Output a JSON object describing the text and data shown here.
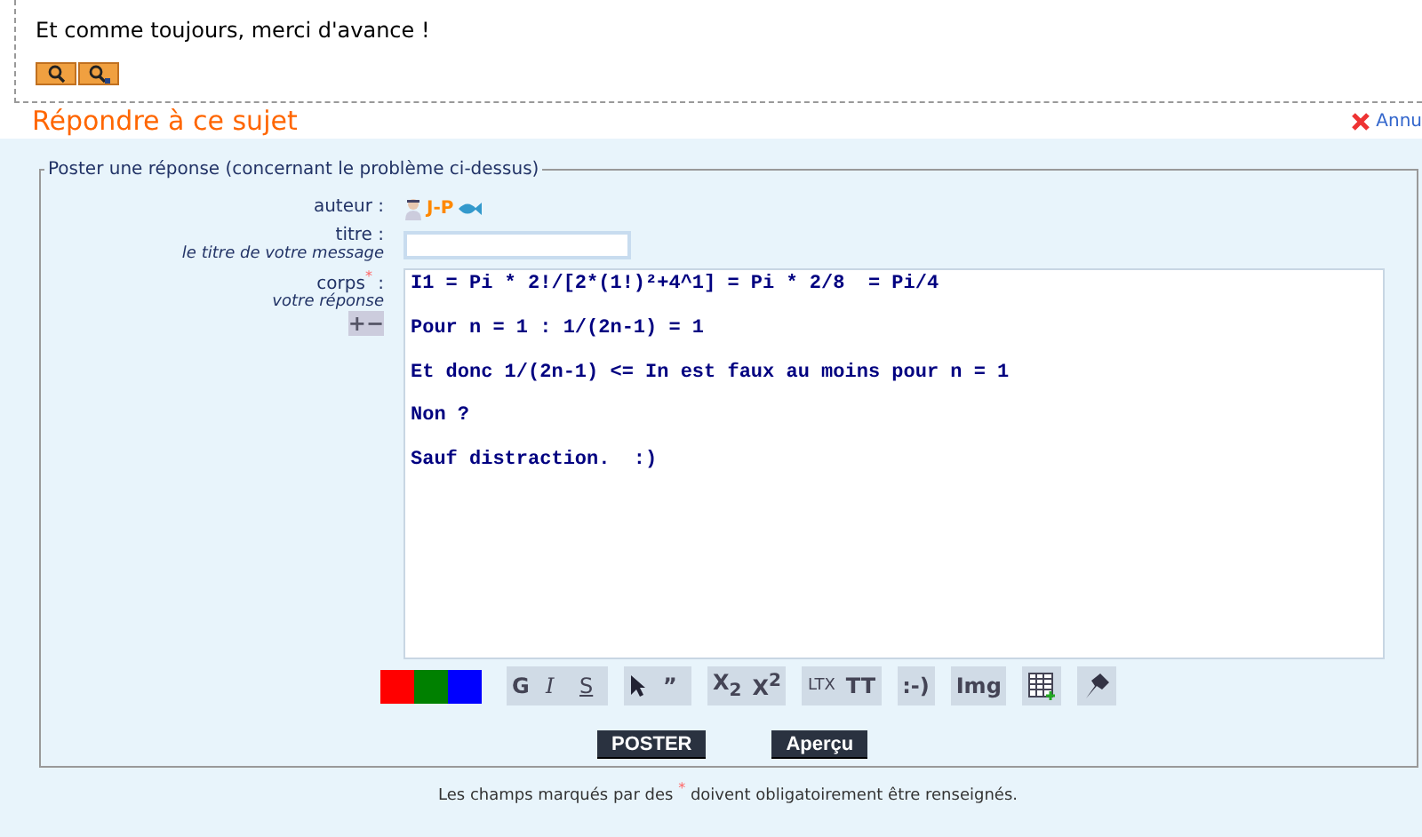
{
  "message": {
    "text": "Et comme toujours, merci d'avance !"
  },
  "reply": {
    "title": "Répondre à ce sujet",
    "cancel": "Annu"
  },
  "form": {
    "legend": "Poster une réponse (concernant le problème ci-dessus)",
    "author_label": "auteur :",
    "author": "J-P",
    "title_label": "titre :",
    "title_hint": "le titre de votre message",
    "body_label": "corps",
    "required_mark": "*",
    "body_colon": ":",
    "body_hint": "votre réponse",
    "resize_controls": "+−",
    "body_paragraphs": [
      "I1 = Pi * 2!/[2*(1!)²+4^1] = Pi * 2/8  = Pi/4",
      "Pour n = 1 : 1/(2n-1) = 1",
      "Et donc 1/(2n-1) <= In est faux au moins pour n = 1",
      "Non ?",
      "Sauf distraction.  :)"
    ],
    "colors": [
      {
        "color": "#ff0000"
      },
      {
        "color": "#008000"
      },
      {
        "color": "#0000ff"
      }
    ],
    "tool_groups": [
      [
        {
          "kind": "text",
          "label": "G"
        },
        {
          "kind": "italic",
          "label": "I"
        },
        {
          "kind": "underline",
          "label": "S"
        }
      ],
      [
        {
          "kind": "cursor"
        },
        {
          "kind": "text",
          "label": "”"
        }
      ],
      [
        {
          "kind": "text",
          "label": "X$_{2}$"
        },
        {
          "kind": "text",
          "label": "X$^{2}$"
        }
      ],
      [
        {
          "kind": "small",
          "label": "LTX"
        },
        {
          "kind": "text",
          "label": "TT"
        }
      ],
      [
        {
          "kind": "text",
          "label": ":-)"
        }
      ],
      [
        {
          "kind": "text",
          "label": "Img"
        }
      ],
      [
        {
          "kind": "table"
        }
      ],
      [
        {
          "kind": "pin"
        }
      ]
    ],
    "buttons": [
      "POSTER",
      "Aperçu"
    ],
    "note_before": "Les champs marqués par des",
    "note_mark": "*",
    "note_after": "doivent obligatoirement être renseignés."
  }
}
